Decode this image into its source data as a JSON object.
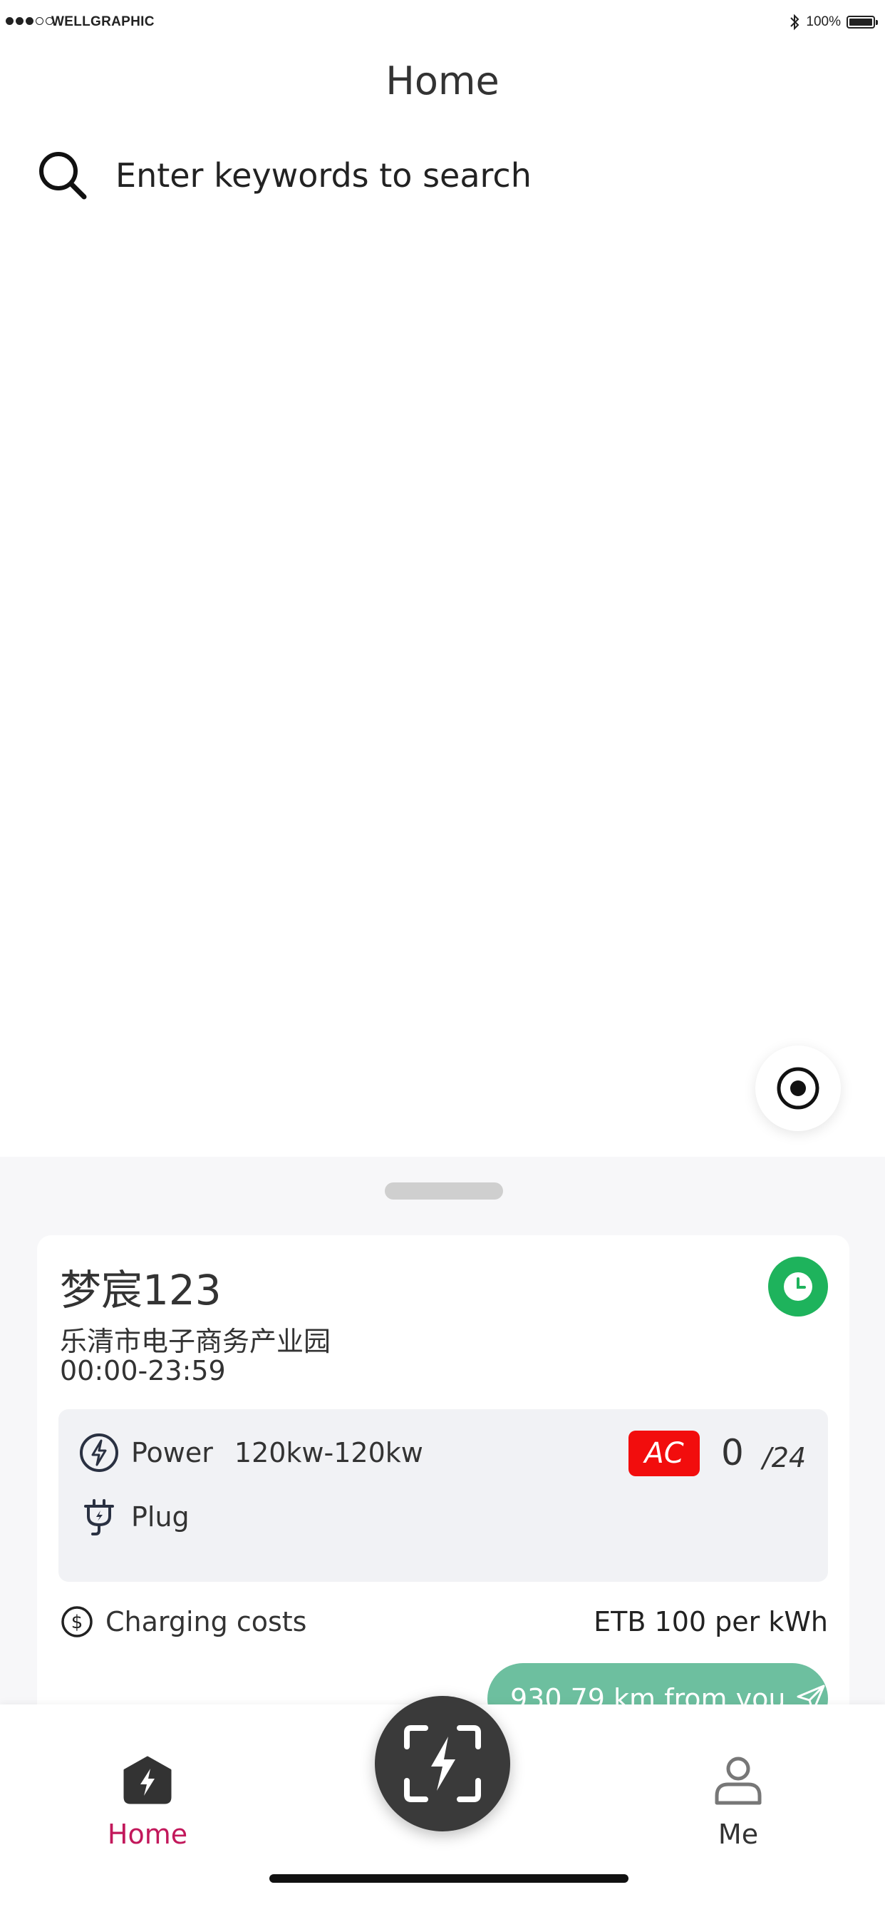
{
  "status_bar": {
    "carrier": "WELLGRAPHIC",
    "battery_text": "100%"
  },
  "header": {
    "title": "Home"
  },
  "search": {
    "placeholder": "Enter keywords to search",
    "icon": "search-icon"
  },
  "map": {
    "locate_icon": "locate-icon"
  },
  "station": {
    "name": "梦宸123",
    "address": "乐清市电子商务产业园",
    "hours": "00:00-23:59",
    "status_color": "#1eb35c",
    "power_label": "Power",
    "power_value": "120kw-120kw",
    "plug_label": "Plug",
    "connector_type": "AC",
    "connector_color": "#f20d0d",
    "available": "0",
    "total": "/24",
    "cost_label": "Charging costs",
    "cost_value": "ETB 100 per kWh",
    "distance": "930.79 km from you",
    "distance_color": "#6dbf9f"
  },
  "tab_bar": {
    "home_label": "Home",
    "me_label": "Me",
    "active_color": "#c2185b"
  }
}
